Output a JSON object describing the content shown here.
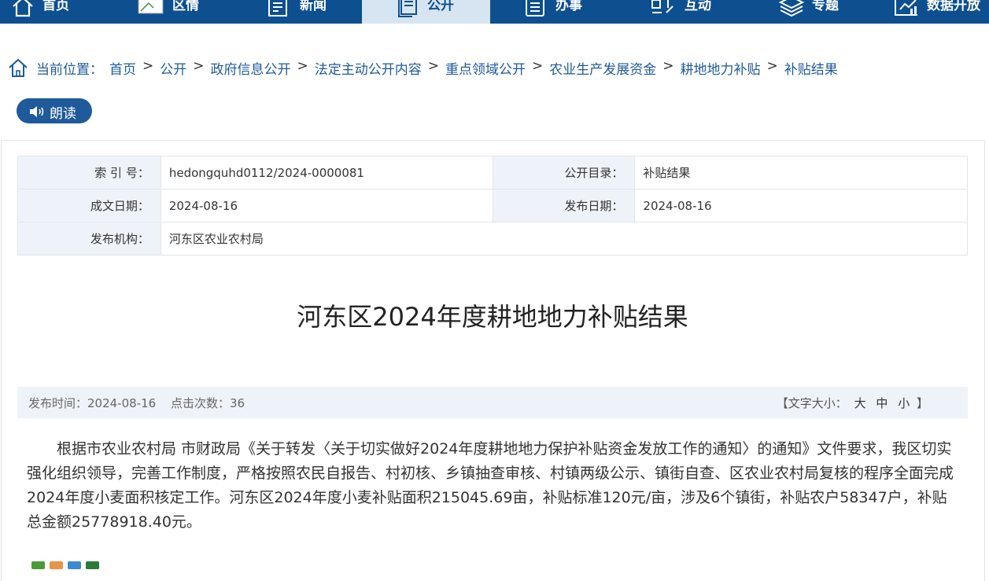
{
  "nav": {
    "items": [
      {
        "label": "首页",
        "icon": "home-icon"
      },
      {
        "label": "区情",
        "icon": "broken-image-icon"
      },
      {
        "label": "新闻",
        "icon": "news-icon"
      },
      {
        "label": "公开",
        "icon": "document-icon"
      },
      {
        "label": "办事",
        "icon": "list-icon"
      },
      {
        "label": "互动",
        "icon": "interaction-icon"
      },
      {
        "label": "专题",
        "icon": "layers-icon"
      },
      {
        "label": "数据开放",
        "icon": "data-icon"
      }
    ],
    "active": "公开"
  },
  "breadcrumb": {
    "label": "当前位置：",
    "items": [
      "首页",
      "公开",
      "政府信息公开",
      "法定主动公开内容",
      "重点领域公开",
      "农业生产发展资金",
      "耕地地力补贴",
      "补贴结果"
    ],
    "separator": ">"
  },
  "read_button": {
    "label": "朗读"
  },
  "meta": {
    "index_label": "索 引 号：",
    "index_value": "hedongquhd0112/2024-0000081",
    "catalog_label": "公开目录：",
    "catalog_value": "补贴结果",
    "written_label": "成文日期：",
    "written_value": "2024-08-16",
    "publish_label": "发布日期：",
    "publish_value": "2024-08-16",
    "org_label": "发布机构：",
    "org_value": "河东区农业农村局"
  },
  "title": "河东区2024年度耕地地力补贴结果",
  "info": {
    "publish_time": "发布时间：2024-08-16",
    "clicks": "点击次数：36",
    "font_size_open": "【文字大小：",
    "size_large": "大",
    "size_medium": "中",
    "size_small": "小",
    "font_size_close": "】"
  },
  "article": {
    "body": "根据市农业农村局 市财政局《关于转发〈关于切实做好2024年度耕地地力保护补贴资金发放工作的通知〉的通知》文件要求，我区切实强化组织领导，完善工作制度，严格按照农民自报告、村初核、乡镇抽查审核、村镇两级公示、镇街自查、区农业农村局复核的程序全面完成2024年度小麦面积核定工作。河东区2024年度小麦补贴面积215045.69亩，补贴标准120元/亩，涉及6个镇街，补贴农户58347户，补贴总金额25778918.40元。"
  },
  "colors": {
    "nav_bg": "#0d4f8f",
    "nav_active_bg": "#d7e5f2",
    "link": "#1f5a9a",
    "meta_key_bg": "#eef3f9"
  }
}
